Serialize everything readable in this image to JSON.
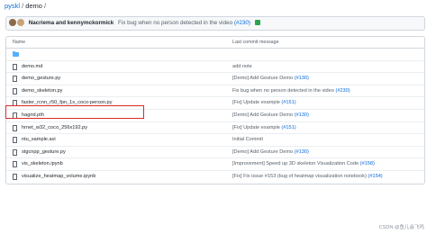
{
  "breadcrumb": {
    "repo": "pyskl",
    "separator": "/",
    "folder": "demo",
    "trailing": "/"
  },
  "latest_commit": {
    "authors": "Nacriema and kennymckormick",
    "message": "Fix bug when no person detected in the video",
    "pr": "(#230)"
  },
  "table_header": {
    "name": "Name",
    "last_commit_message": "Last commit message"
  },
  "rows": [
    {
      "type": "folder",
      "name": "..",
      "message": "",
      "pr": ""
    },
    {
      "type": "file",
      "name": "demo.md",
      "message": "add note",
      "pr": ""
    },
    {
      "type": "file",
      "name": "demo_gesture.py",
      "message": "[Demo] Add Gesture Demo",
      "pr": "(#130)"
    },
    {
      "type": "file",
      "name": "demo_skeleton.py",
      "message": "Fix bug when no person detected in the video",
      "pr": "(#230)"
    },
    {
      "type": "file",
      "name": "faster_rcnn_r50_fpn_1x_coco-person.py",
      "message": "[Fix] Update example",
      "pr": "(#151)"
    },
    {
      "type": "file",
      "name": "hagrid.pth",
      "message": "[Demo] Add Gesture Demo",
      "pr": "(#130)"
    },
    {
      "type": "file",
      "name": "hrnet_w32_coco_256x192.py",
      "message": "[Fix] Update example",
      "pr": "(#151)"
    },
    {
      "type": "file",
      "name": "ntu_sample.avi",
      "message": "Initial Commit",
      "pr": ""
    },
    {
      "type": "file",
      "name": "stgcnpp_gesture.py",
      "message": "[Demo] Add Gesture Demo",
      "pr": "(#130)"
    },
    {
      "type": "file",
      "name": "vis_skeleton.ipynb",
      "message": "[Improvement] Speed up 3D skeleton Visualization Code",
      "pr": "(#158)"
    },
    {
      "type": "file",
      "name": "visualize_heatmap_volume.ipynb",
      "message": "[Fix] Fix issue #153 (bug of heatmap visualization notebook)",
      "pr": "(#154)"
    }
  ],
  "highlighted_row": "faster_rcnn_r50_fpn_1x_coco-person.py",
  "colors": {
    "link": "#0969da",
    "folder": "#54aeff",
    "highlight_border": "#d92b2b"
  },
  "watermark": "CSDN @鱼儿会飞吗"
}
